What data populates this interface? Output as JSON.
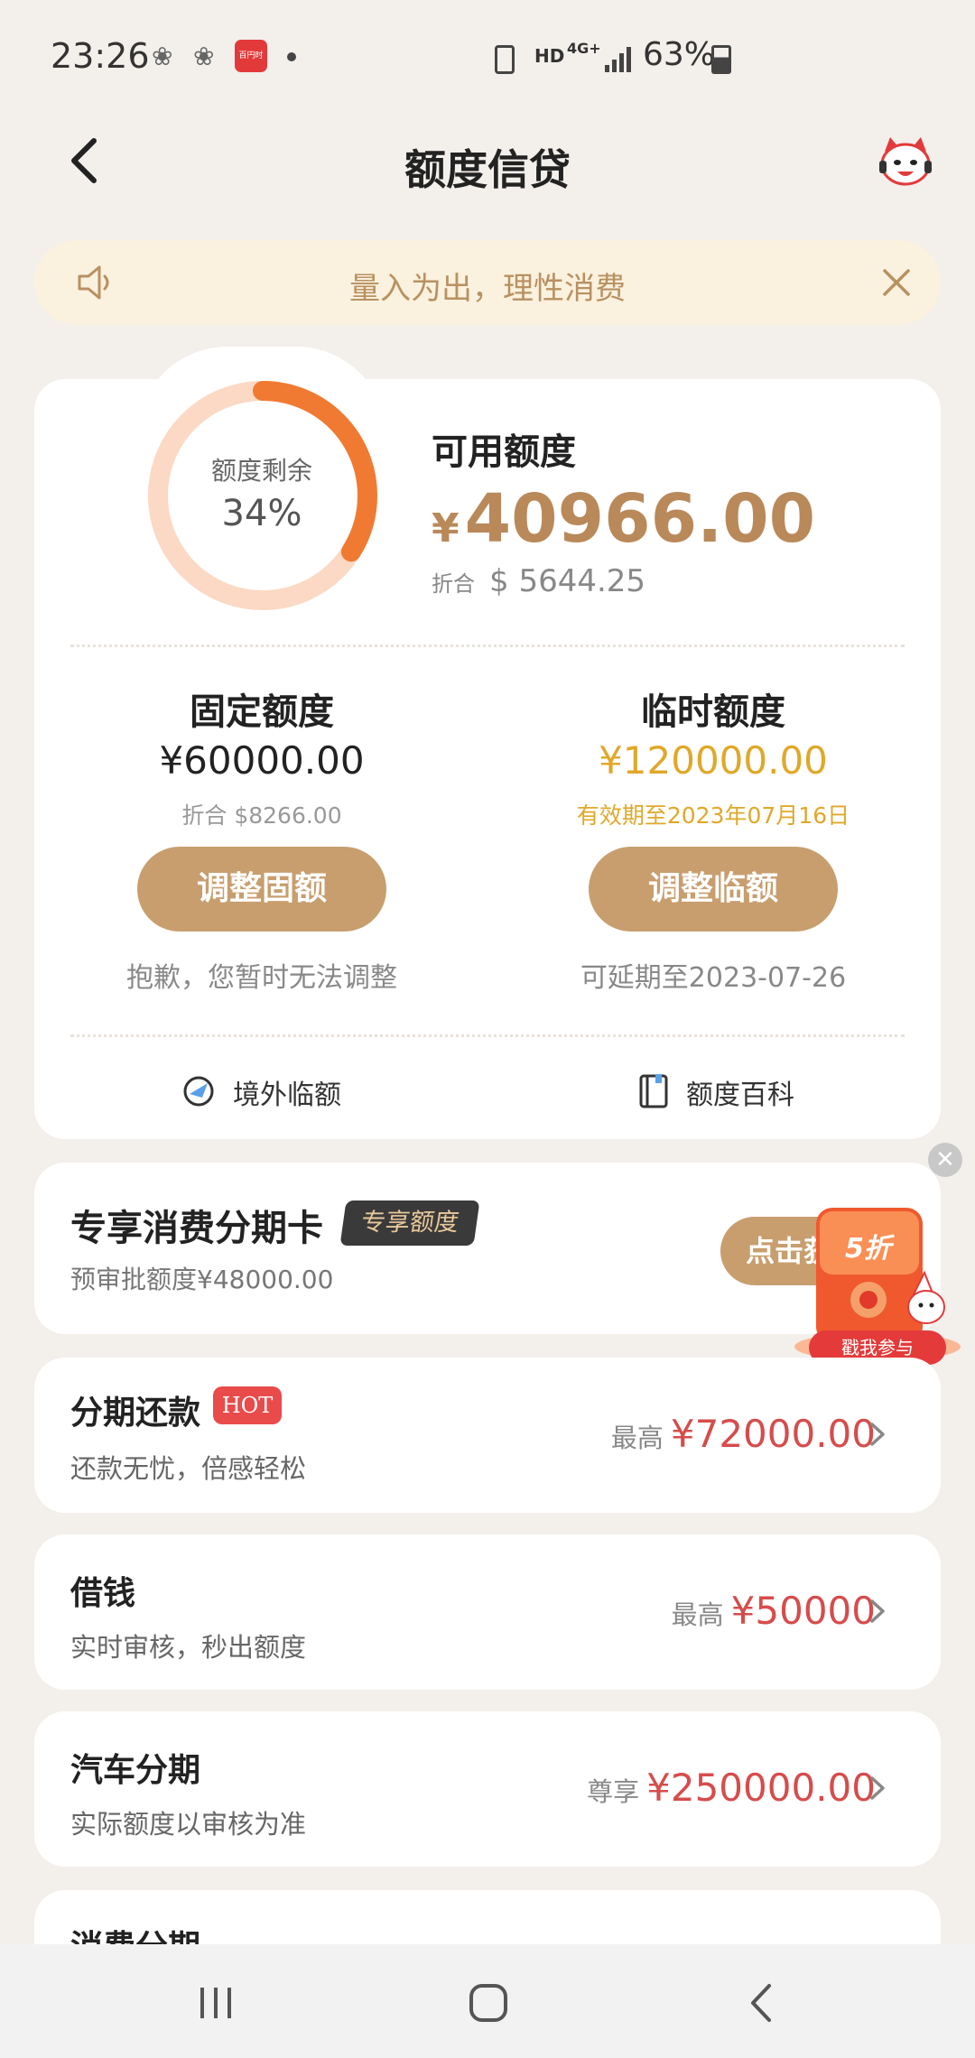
{
  "status_bar": {
    "time": "23:26",
    "app_badge": "百円时",
    "network": "HD",
    "network_gen": "4G+",
    "battery": "63%"
  },
  "header": {
    "title": "额度信贷",
    "back_icon": "chevron-left-icon",
    "service_icon": "mascot-cat-icon"
  },
  "notice": {
    "text": "量入为出，理性消费",
    "icon": "speaker-icon",
    "close_icon": "close-icon"
  },
  "credit": {
    "ring_label": "额度剩余",
    "ring_percent": "34%",
    "ring_fraction": 0.34,
    "available_label": "可用额度",
    "available_currency": "¥",
    "available_amount": "40966.00",
    "usd_prefix": "折合",
    "usd_amount": "$ 5644.25",
    "fixed": {
      "title": "固定额度",
      "value": "¥60000.00",
      "sub": "折合 $8266.00",
      "button": "调整固额",
      "note": "抱歉，您暂时无法调整"
    },
    "temp": {
      "title": "临时额度",
      "value": "¥120000.00",
      "sub": "有效期至2023年07月16日",
      "button": "调整临额",
      "note": "可延期至2023-07-26"
    },
    "links": [
      {
        "label": "境外临额",
        "icon": "globe-plane-icon"
      },
      {
        "label": "额度百科",
        "icon": "book-icon"
      }
    ]
  },
  "promo": {
    "title": "专享消费分期卡",
    "tag": "专享额度",
    "sub": "预审批额度¥48000.00",
    "button": "点击获",
    "redpack_discount": "5折",
    "redpack_label": "戳我参与"
  },
  "products": [
    {
      "title": "分期还款",
      "badge": "HOT",
      "sub": "还款无忧，倍感轻松",
      "prefix": "最高",
      "amount": "¥72000.00"
    },
    {
      "title": "借钱",
      "sub": "实时审核，秒出额度",
      "prefix": "最高",
      "amount": "¥50000"
    },
    {
      "title": "汽车分期",
      "sub": "实际额度以审核为准",
      "prefix": "尊享",
      "amount": "¥250000.00"
    },
    {
      "title": "消费分期"
    }
  ],
  "colors": {
    "accent_gold": "#c89e6e",
    "amount_gold": "#b9895a",
    "temp_yellow": "#e0a82a",
    "ring_orange": "#f07a32",
    "ring_track": "#fbd9c4",
    "amount_red": "#d64c4c",
    "notice_bg": "#fbf1df"
  }
}
